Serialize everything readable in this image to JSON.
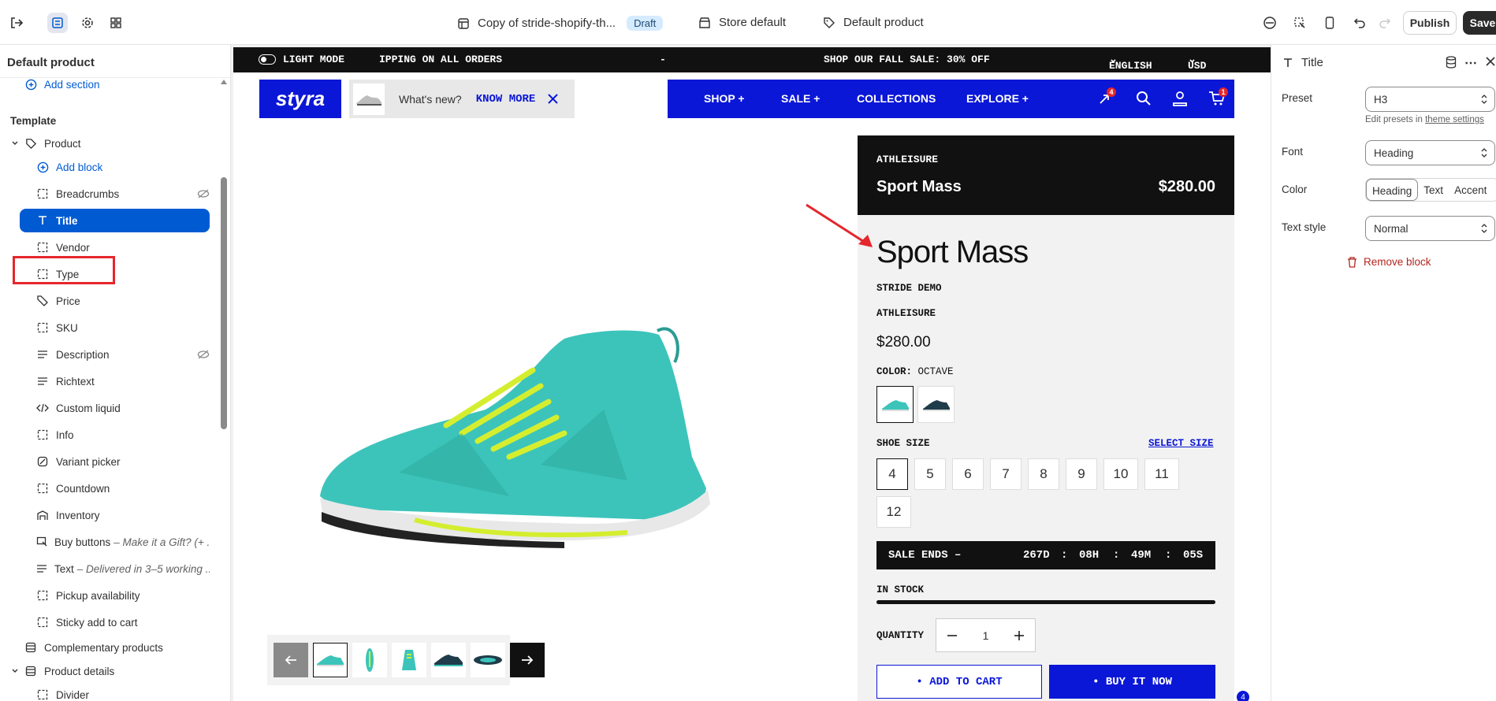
{
  "topbar": {
    "theme_name": "Copy of stride-shopify-th...",
    "draft_badge": "Draft",
    "store": "Store default",
    "template": "Default product",
    "publish": "Publish",
    "save": "Save"
  },
  "left_panel": {
    "title": "Default product",
    "add_section": "Add section",
    "template_heading": "Template",
    "product": "Product",
    "add_block": "Add block",
    "blocks": [
      "Breadcrumbs",
      "Title",
      "Vendor",
      "Type",
      "Price",
      "SKU",
      "Description",
      "Richtext",
      "Custom liquid",
      "Info",
      "Variant picker",
      "Countdown",
      "Inventory",
      "Buy buttons",
      "Text",
      "Pickup availability",
      "Sticky add to cart"
    ],
    "buy_buttons_note": "– Make it a Gift? (+ ...",
    "text_note": "– Delivered in 3–5 working ...",
    "complementary": "Complementary products",
    "product_details": "Product details",
    "divider": "Divider"
  },
  "right_panel": {
    "title": "Title",
    "preset_label": "Preset",
    "preset_value": "H3",
    "preset_help": "Edit presets in",
    "preset_help_link": "theme settings",
    "font_label": "Font",
    "font_value": "Heading",
    "color_label": "Color",
    "color_options": [
      "Heading",
      "Text",
      "Accent"
    ],
    "text_style_label": "Text style",
    "text_style_value": "Normal",
    "remove_block": "Remove block"
  },
  "store": {
    "light_mode": "LIGHT MODE",
    "announce_left": "IPPING ON ALL ORDERS",
    "announce_dash": "-",
    "announce_sale": "SHOP OUR FALL SALE: 30% OFF",
    "language": "ENGLISH",
    "currency": "USD $",
    "logo": "styra",
    "whats_new": "What's new?",
    "know_more": "KNOW MORE",
    "nav": [
      "SHOP +",
      "SALE +",
      "COLLECTIONS",
      "EXPLORE +"
    ],
    "wishlist_badge": "4",
    "cart_badge": "1",
    "card_category": "ATHLEISURE",
    "card_title": "Sport Mass",
    "card_price": "$280.00",
    "product_title": "Sport Mass",
    "vendor": "STRIDE DEMO",
    "type": "ATHLEISURE",
    "price": "$280.00",
    "color_label": "COLOR:",
    "color_value": "OCTAVE",
    "shoe_size_label": "SHOE SIZE",
    "select_size": "SELECT SIZE",
    "sizes": [
      "4",
      "5",
      "6",
      "7",
      "8",
      "9",
      "10",
      "11",
      "12"
    ],
    "sale_ends": "SALE ENDS –",
    "countdown": [
      "267D",
      ":",
      "08H",
      ":",
      "49M",
      ":",
      "05S"
    ],
    "in_stock": "IN STOCK",
    "quantity_label": "QUANTITY",
    "quantity": "1",
    "add_to_cart": "• ADD TO CART",
    "buy_now": "• BUY IT NOW",
    "corner_badge": "4"
  },
  "colors": {
    "brand_blue": "#0b17d6",
    "editor_blue": "#005bd3",
    "shoe_teal": "#3cc4bb",
    "lace_lime": "#d4ee2f",
    "annotation_red": "#e5262c"
  }
}
